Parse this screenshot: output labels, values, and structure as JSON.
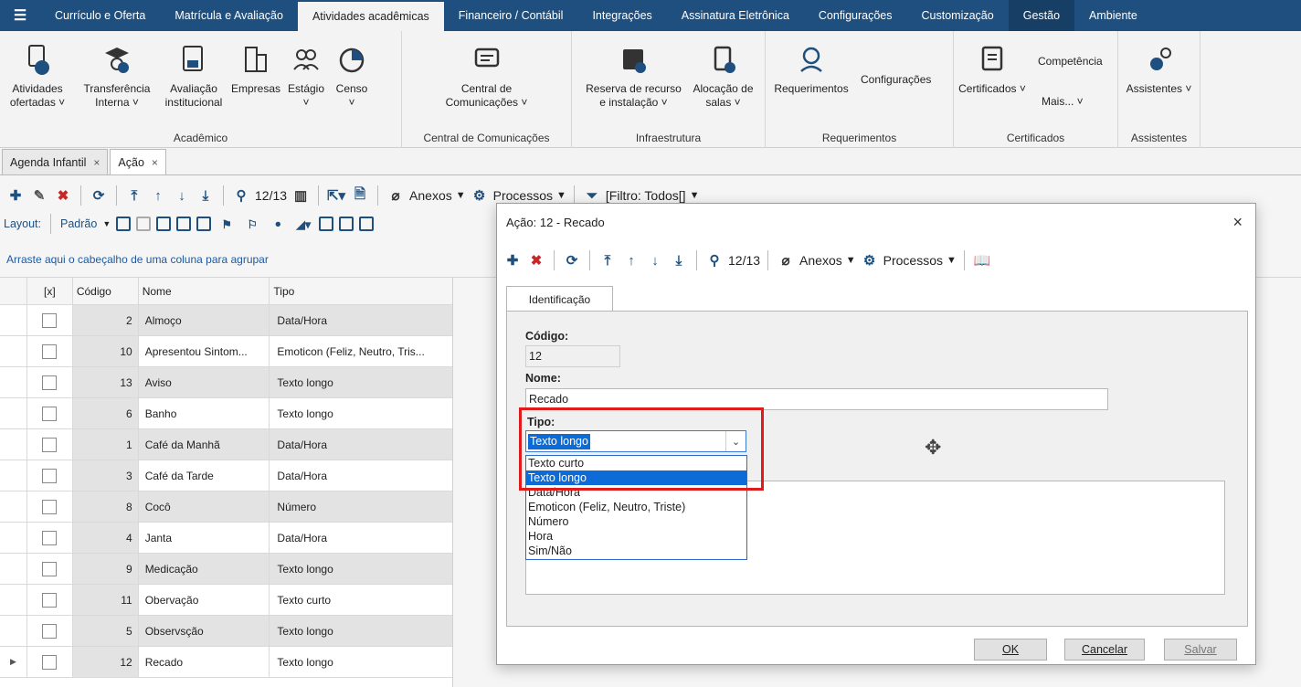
{
  "menubar": {
    "tabs": [
      "Currículo e Oferta",
      "Matrícula e Avaliação",
      "Atividades acadêmicas",
      "Financeiro / Contábil",
      "Integrações",
      "Assinatura Eletrônica",
      "Configurações",
      "Customização",
      "Gestão",
      "Ambiente"
    ],
    "active_tab": "Atividades acadêmicas"
  },
  "ribbon": {
    "groups": [
      {
        "name": "Acadêmico",
        "buttons": [
          "Atividades ofertadas ˅",
          "Transferência Interna ˅",
          "Avaliação institucional",
          "Empresas",
          "Estágio ˅",
          "Censo ˅"
        ]
      },
      {
        "name": "Central de Comunicações",
        "buttons": [
          "Central de Comunicações ˅"
        ]
      },
      {
        "name": "Infraestrutura",
        "buttons": [
          "Reserva de recurso e instalação ˅",
          "Alocação de salas ˅"
        ]
      },
      {
        "name": "Requerimentos",
        "buttons": [
          "Requerimentos",
          "Configurações"
        ]
      },
      {
        "name": "Certificados",
        "buttons": [
          "Certificados ˅",
          "Competência",
          "Mais... ˅"
        ]
      },
      {
        "name": "Assistentes",
        "buttons": [
          "Assistentes ˅"
        ]
      }
    ]
  },
  "doctabs": [
    {
      "label": "Agenda Infantil",
      "close": "×"
    },
    {
      "label": "Ação",
      "close": "×"
    }
  ],
  "toolbar": {
    "record_counter": "12/13",
    "anexos": "Anexos",
    "processos": "Processos",
    "filtro": "[Filtro: Todos[]",
    "layout_label": "Layout:",
    "layout_value": "Padrão"
  },
  "group_hint": "Arraste aqui o cabeçalho de uma coluna para agrupar",
  "grid": {
    "columns": [
      "[x]",
      "Código",
      "Nome",
      "Tipo"
    ],
    "rows": [
      {
        "codigo": "2",
        "nome": "Almoço",
        "tipo": "Data/Hora"
      },
      {
        "codigo": "10",
        "nome": "Apresentou Sintom...",
        "tipo": "Emoticon (Feliz, Neutro, Tris..."
      },
      {
        "codigo": "13",
        "nome": "Aviso",
        "tipo": "Texto longo"
      },
      {
        "codigo": "6",
        "nome": "Banho",
        "tipo": "Texto longo"
      },
      {
        "codigo": "1",
        "nome": "Café da Manhã",
        "tipo": "Data/Hora"
      },
      {
        "codigo": "3",
        "nome": "Café da Tarde",
        "tipo": "Data/Hora"
      },
      {
        "codigo": "8",
        "nome": "Cocô",
        "tipo": "Número"
      },
      {
        "codigo": "4",
        "nome": "Janta",
        "tipo": "Data/Hora"
      },
      {
        "codigo": "9",
        "nome": "Medicação",
        "tipo": "Texto longo"
      },
      {
        "codigo": "11",
        "nome": "Obervação",
        "tipo": "Texto curto"
      },
      {
        "codigo": "5",
        "nome": "Observsção",
        "tipo": "Texto longo"
      },
      {
        "codigo": "12",
        "nome": "Recado",
        "tipo": "Texto longo"
      }
    ]
  },
  "dialog": {
    "title": "Ação: 12 - Recado",
    "close": "×",
    "record_counter": "12/13",
    "anexos": "Anexos",
    "processos": "Processos",
    "tab": "Identificação",
    "codigo_label": "Código:",
    "codigo_value": "12",
    "nome_label": "Nome:",
    "nome_value": "Recado",
    "tipo_label": "Tipo:",
    "tipo_value": "Texto longo",
    "tipo_options": [
      "Texto curto",
      "Texto longo",
      "Data/Hora",
      "Emoticon (Feliz, Neutro, Triste)",
      "Número",
      "Hora",
      "Sim/Não"
    ],
    "tipo_selected_index": 1,
    "ok": "OK",
    "cancelar": "Cancelar",
    "salvar": "Salvar"
  },
  "colors": {
    "menubar": "#1e4f7e",
    "accent": "#1e4f7e",
    "highlight": "#e01b1b",
    "selection": "#0c6bd6"
  }
}
